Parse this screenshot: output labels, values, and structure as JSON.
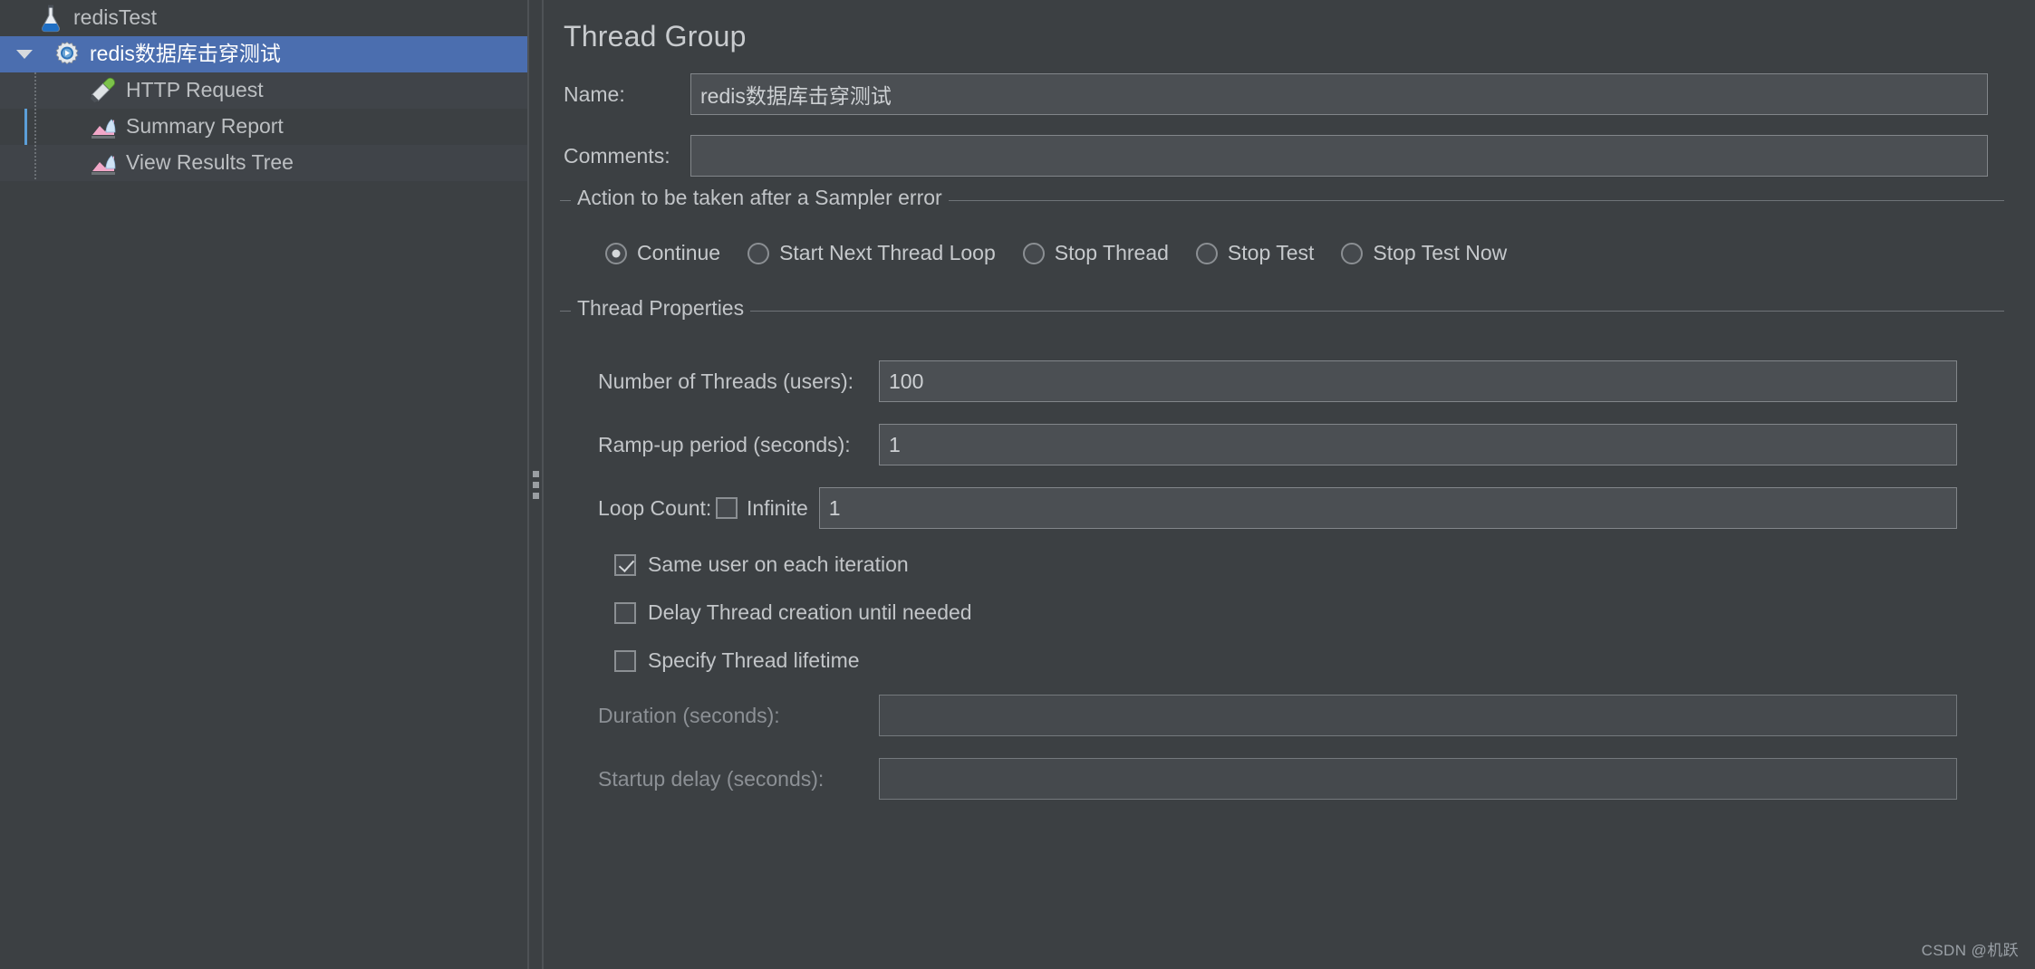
{
  "tree": {
    "items": [
      {
        "label": "redisTest",
        "icon": "jmeter-flask-icon",
        "depth": 0,
        "selected": false,
        "expandable": false
      },
      {
        "label": "redis数据库击穿测试",
        "icon": "thread-group-gear-icon",
        "depth": 1,
        "selected": true,
        "expandable": true
      },
      {
        "label": "HTTP Request",
        "icon": "http-sampler-pipette-icon",
        "depth": 2,
        "selected": false,
        "expandable": false
      },
      {
        "label": "Summary Report",
        "icon": "listener-chart-icon",
        "depth": 2,
        "selected": false,
        "expandable": false
      },
      {
        "label": "View Results Tree",
        "icon": "listener-chart-icon",
        "depth": 2,
        "selected": false,
        "expandable": false
      }
    ]
  },
  "panel": {
    "title": "Thread Group",
    "name_label": "Name:",
    "name_value": "redis数据库击穿测试",
    "comments_label": "Comments:",
    "comments_value": "",
    "comments_placeholder": ""
  },
  "sampler_error": {
    "group_title": "Action to be taken after a Sampler error",
    "selected": "Continue",
    "options": [
      {
        "label": "Continue",
        "checked": true
      },
      {
        "label": "Start Next Thread Loop",
        "checked": false
      },
      {
        "label": "Stop Thread",
        "checked": false
      },
      {
        "label": "Stop Test",
        "checked": false
      },
      {
        "label": "Stop Test Now",
        "checked": false
      }
    ]
  },
  "thread_properties": {
    "group_title": "Thread Properties",
    "num_threads_label": "Number of Threads (users):",
    "num_threads_value": "100",
    "ramp_up_label": "Ramp-up period (seconds):",
    "ramp_up_value": "1",
    "loop_count_label": "Loop Count:",
    "infinite_label": "Infinite",
    "infinite_checked": false,
    "loop_count_value": "1",
    "same_user_label": "Same user on each iteration",
    "same_user_checked": true,
    "delay_thread_label": "Delay Thread creation until needed",
    "delay_thread_checked": false,
    "specify_lifetime_label": "Specify Thread lifetime",
    "specify_lifetime_checked": false,
    "duration_label": "Duration (seconds):",
    "duration_value": "",
    "duration_enabled": false,
    "startup_delay_label": "Startup delay (seconds):",
    "startup_delay_value": "",
    "startup_delay_enabled": false
  },
  "watermark": {
    "text": "CSDN @机跃"
  },
  "colors": {
    "background": "#3c4043",
    "selection": "#4b6eaf",
    "field_bg": "#4b4f53",
    "field_border": "#82868a",
    "text": "#c2c5c8",
    "text_dim": "#8c9095",
    "guide_line": "#5c9fd8"
  }
}
